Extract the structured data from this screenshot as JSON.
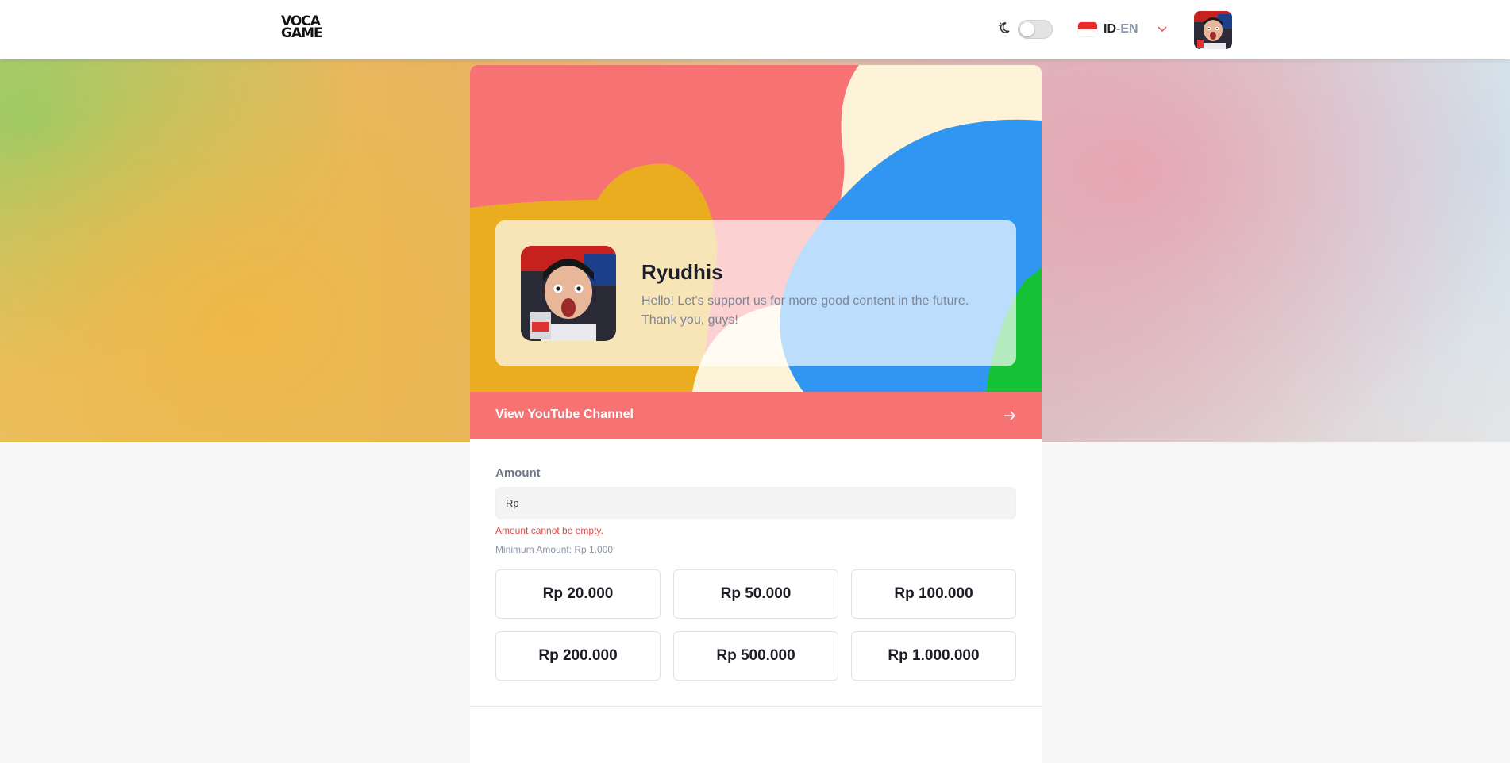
{
  "header": {
    "logo_line1": "VOCA",
    "logo_line2": "GAME",
    "theme_icon": "moon-icon",
    "lang_id": "ID",
    "lang_sep": "-",
    "lang_en": "EN",
    "lang_chevron_icon": "chevron-down-icon",
    "flag_icon": "indonesia-flag-icon"
  },
  "profile": {
    "name": "Ryudhis",
    "description": "Hello! Let's support us for more good content in the future. Thank you, guys!"
  },
  "youtube": {
    "label": "View YouTube Channel",
    "arrow_icon": "arrow-right-icon"
  },
  "amount": {
    "label": "Amount",
    "prefix_value": "Rp",
    "error": "Amount cannot be empty.",
    "minimum": "Minimum Amount: Rp 1.000"
  },
  "presets": [
    "Rp 20.000",
    "Rp 50.000",
    "Rp 100.000",
    "Rp 200.000",
    "Rp 500.000",
    "Rp 1.000.000"
  ],
  "colors": {
    "accent": "#f67273",
    "blob_blue": "#3196f2",
    "blob_yellow": "#eaad1f",
    "blob_cream": "#fdf3d8",
    "blob_green": "#16c235",
    "error": "#e24848"
  }
}
